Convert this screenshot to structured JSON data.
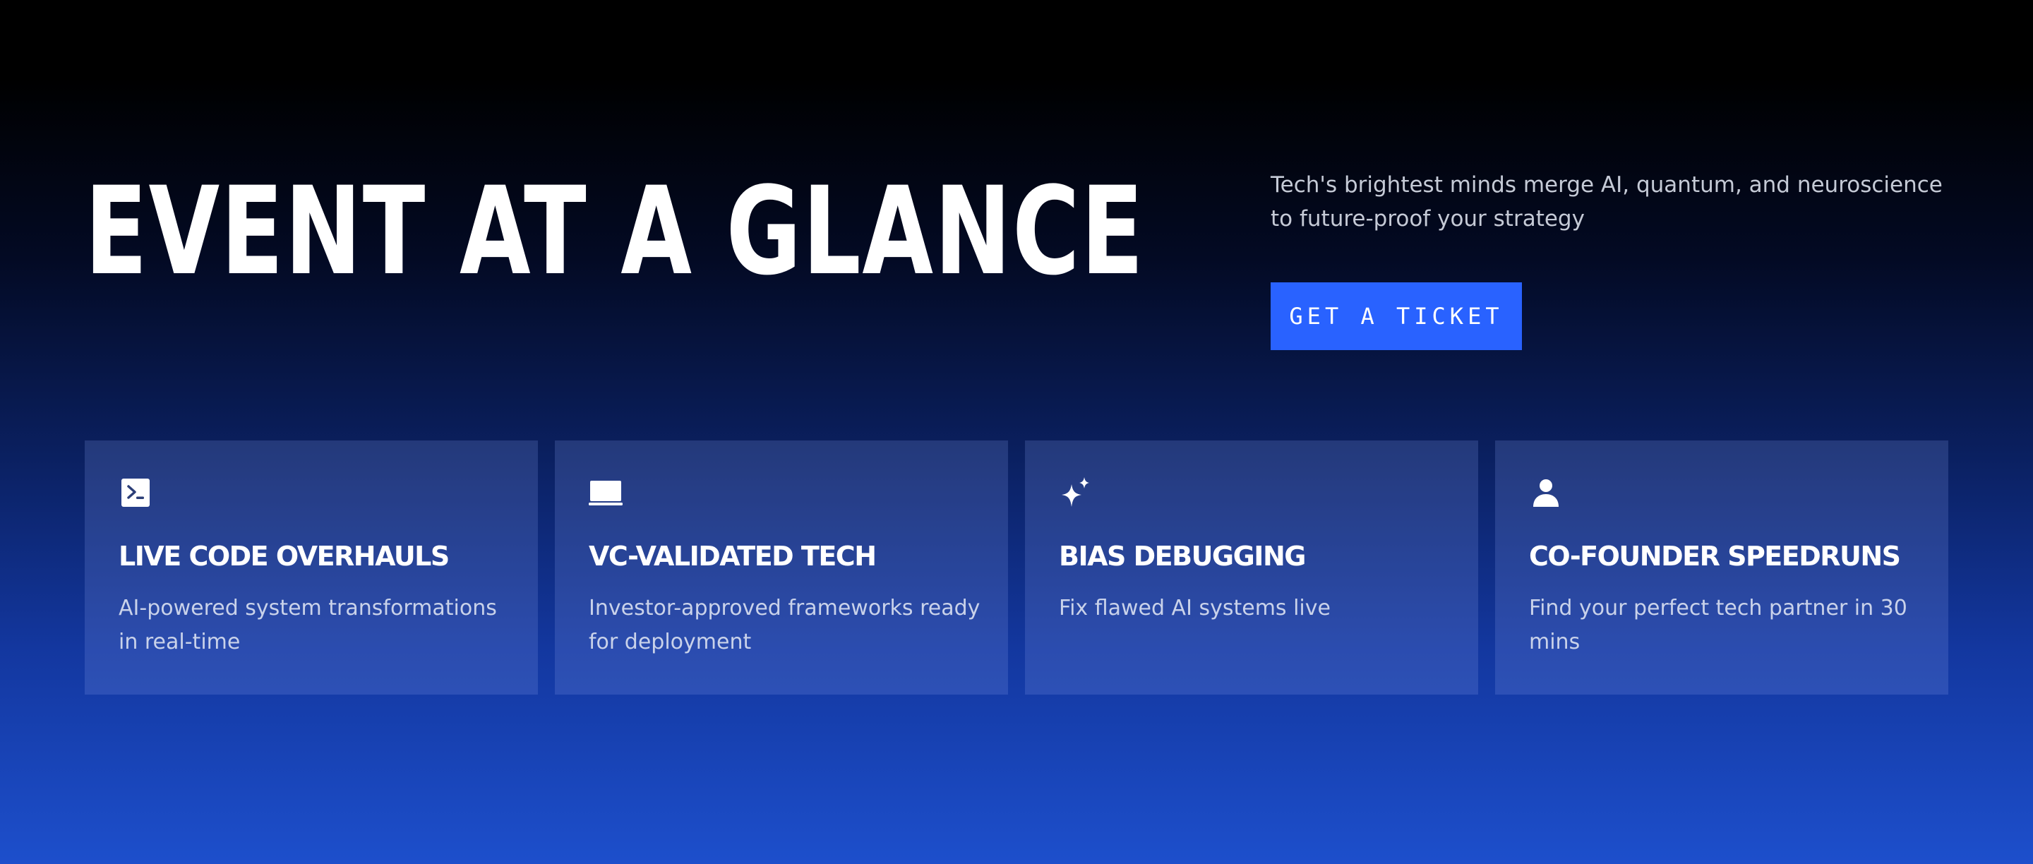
{
  "hero": {
    "title": "EVENT AT A GLANCE",
    "subtitle": "Tech's brightest minds merge AI, quantum, and neuroscience to future-proof your strategy",
    "cta_label": "GET A TICKET"
  },
  "colors": {
    "accent": "#2962ff",
    "gradient_top": "#000000",
    "gradient_bottom": "#1d4fcc",
    "card_background": "#3a4f8c",
    "subtitle_text": "#c5cad6"
  },
  "features": [
    {
      "icon": "terminal-icon",
      "title": "LIVE CODE OVERHAULS",
      "description": "AI-powered system transformations in real-time"
    },
    {
      "icon": "laptop-icon",
      "title": "VC-VALIDATED TECH",
      "description": "Investor-approved frameworks ready for deployment"
    },
    {
      "icon": "sparkles-icon",
      "title": "BIAS DEBUGGING",
      "description": "Fix flawed AI systems live"
    },
    {
      "icon": "user-icon",
      "title": "CO-FOUNDER SPEEDRUNS",
      "description": "Find your perfect tech partner in 30 mins"
    }
  ]
}
